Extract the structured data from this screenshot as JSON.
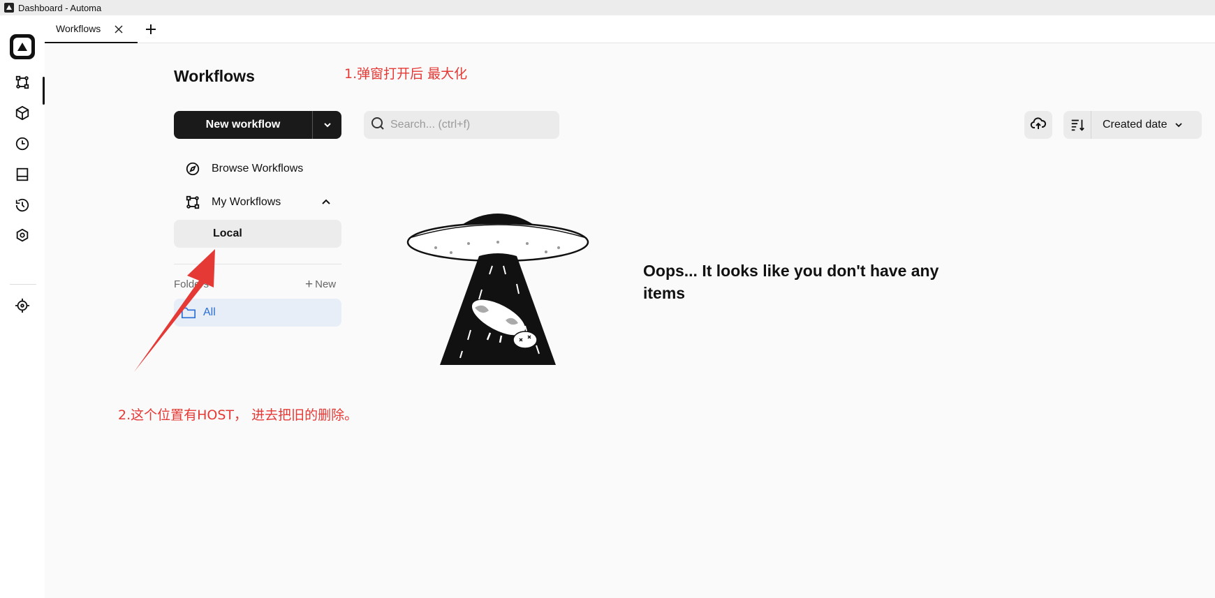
{
  "window": {
    "title": "Dashboard - Automa"
  },
  "tabs": [
    {
      "label": "Workflows"
    }
  ],
  "page": {
    "title": "Workflows"
  },
  "toolbar": {
    "new_workflow_label": "New workflow",
    "search_placeholder": "Search... (ctrl+f)",
    "sort_label": "Created date"
  },
  "sidebar": {
    "browse_label": "Browse Workflows",
    "my_workflows_label": "My Workflows",
    "local_label": "Local",
    "folders_label": "Folders",
    "new_folder_label": "New",
    "all_folder_label": "All"
  },
  "empty_state": {
    "message": "Oops... It looks like you don't have any items"
  },
  "annotations": {
    "note1": "1.弹窗打开后 最大化",
    "note2": "2.这个位置有HOST， 进去把旧的删除。"
  },
  "colors": {
    "annotation": "#e53935",
    "primary": "#1a1a1a",
    "folder_active": "#2a6fd6"
  },
  "icons": {
    "left_nav": [
      "workflow-icon",
      "package-icon",
      "clock-icon",
      "dashboard-icon",
      "history-icon",
      "settings-icon",
      "crosshair-icon"
    ]
  }
}
